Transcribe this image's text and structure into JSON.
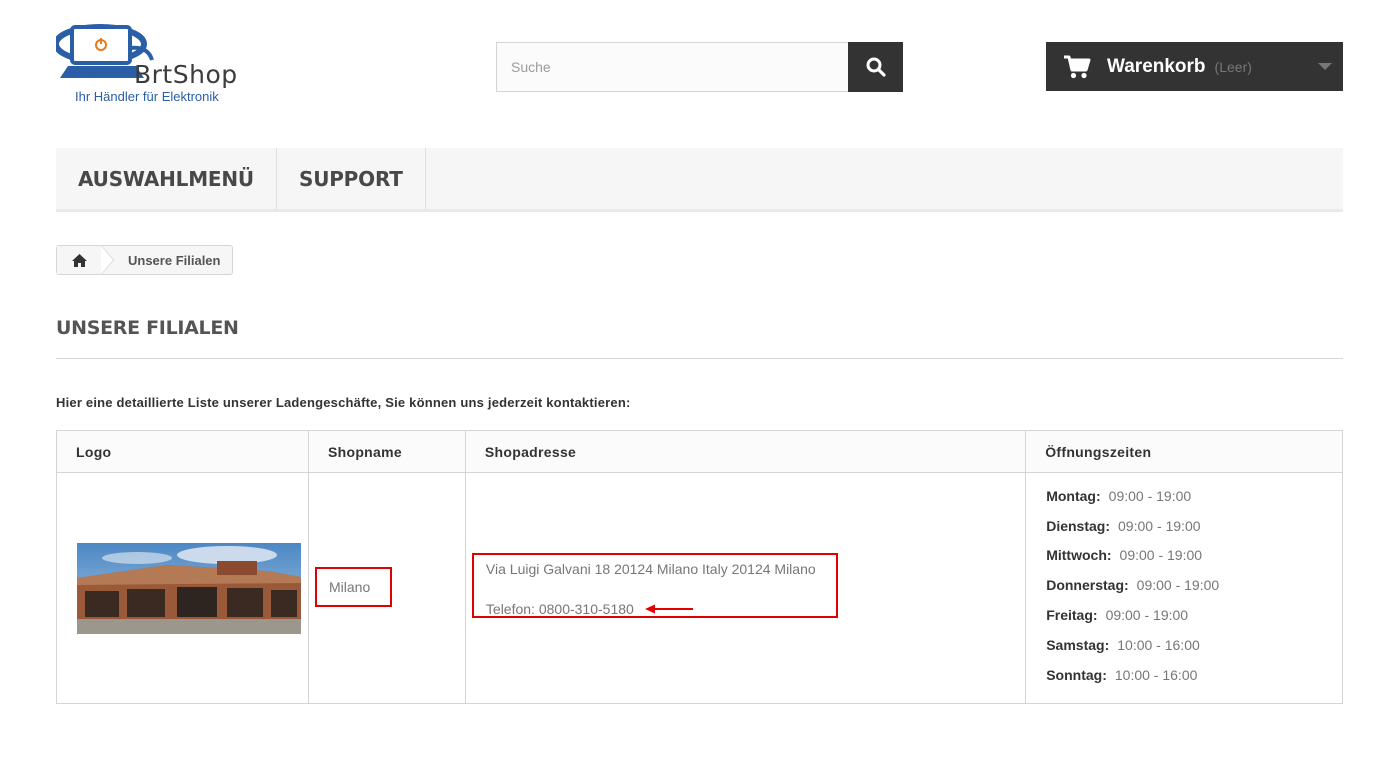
{
  "header": {
    "brand": "BrtShop",
    "tagline": "Ihr Händler für Elektronik",
    "search_placeholder": "Suche",
    "cart_label": "Warenkorb",
    "cart_status": "(Leer)",
    "accent_color": "#333333"
  },
  "nav": {
    "items": [
      {
        "label": "AUSWAHLMENÜ"
      },
      {
        "label": "SUPPORT"
      }
    ]
  },
  "breadcrumb": {
    "home_icon": "home-icon",
    "current": "Unsere Filialen"
  },
  "page": {
    "title": "UNSERE FILIALEN",
    "intro": "Hier eine detaillierte Liste unserer Ladengeschäfte, Sie können uns jederzeit kontaktieren:"
  },
  "table": {
    "headers": [
      "Logo",
      "Shopname",
      "Shopadresse",
      "Öffnungszeiten"
    ],
    "rows": [
      {
        "name": "Milano",
        "address": "Via Luigi Galvani 18 20124 Milano Italy 20124 Milano",
        "phone": "Telefon: 0800-310-5180",
        "hours": [
          {
            "day": "Montag:",
            "time": "09:00 - 19:00"
          },
          {
            "day": "Dienstag:",
            "time": "09:00 - 19:00"
          },
          {
            "day": "Mittwoch:",
            "time": "09:00 - 19:00"
          },
          {
            "day": "Donnerstag:",
            "time": "09:00 - 19:00"
          },
          {
            "day": "Freitag:",
            "time": "09:00 - 19:00"
          },
          {
            "day": "Samstag:",
            "time": "10:00 - 16:00"
          },
          {
            "day": "Sonntag:",
            "time": "10:00 - 16:00"
          }
        ]
      }
    ]
  },
  "annotation_color": "#e00000"
}
